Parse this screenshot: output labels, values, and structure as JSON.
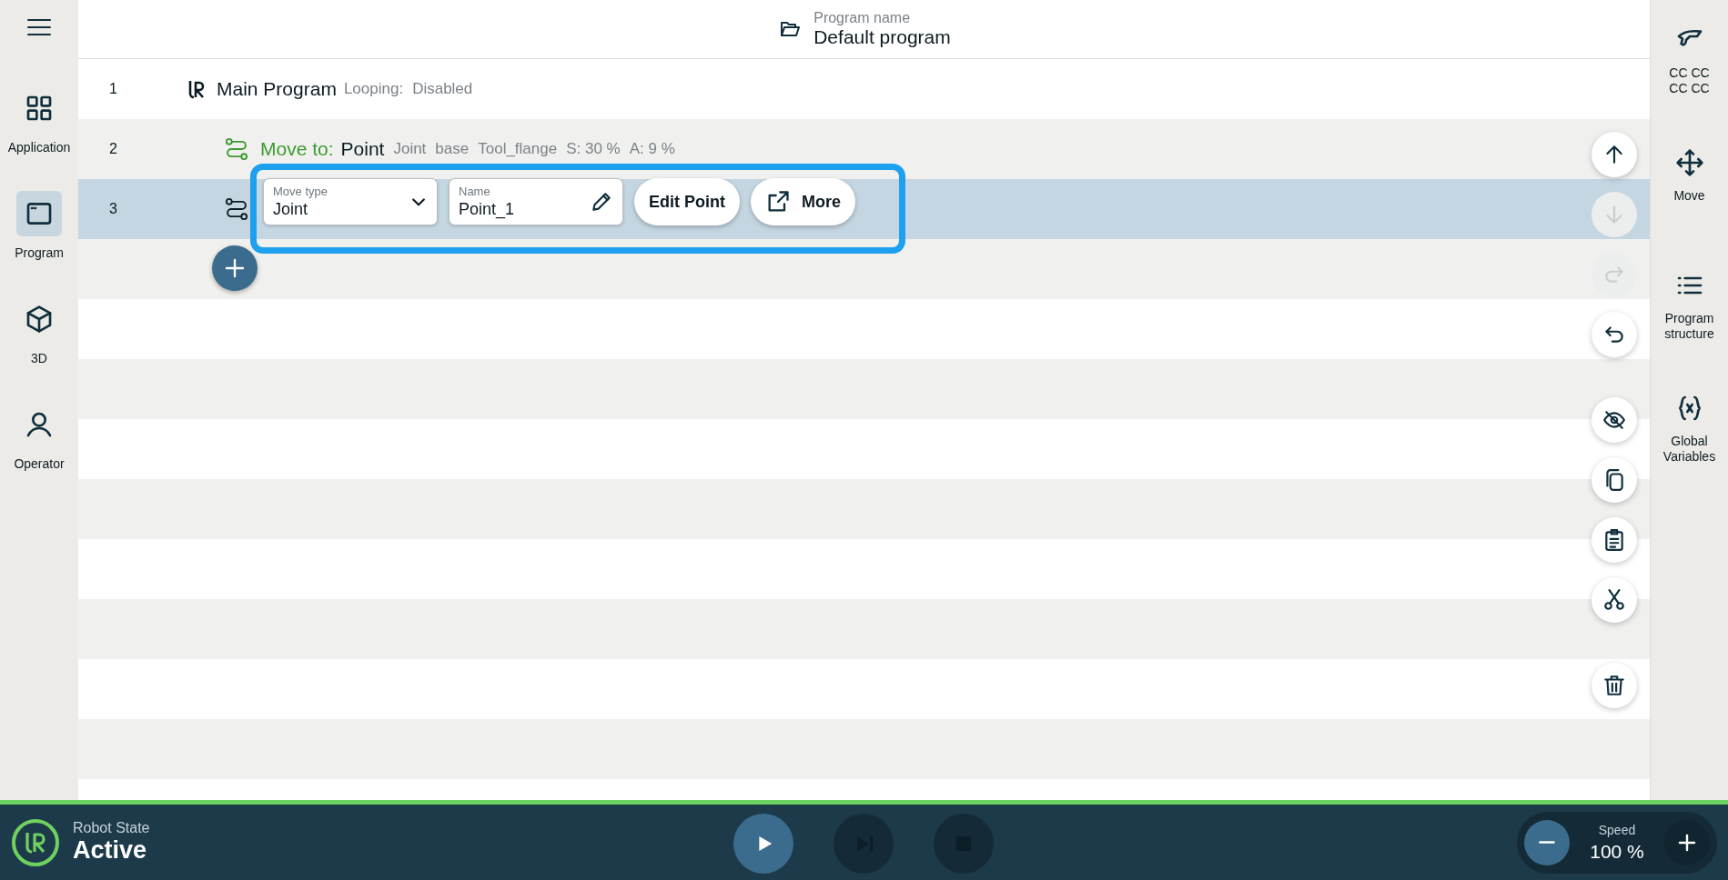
{
  "nav": {
    "items": [
      {
        "kind": "application",
        "label": "Application",
        "selected": false
      },
      {
        "kind": "program",
        "label": "Program",
        "selected": true
      },
      {
        "kind": "cube",
        "label": "3D",
        "selected": false
      },
      {
        "kind": "operator",
        "label": "Operator",
        "selected": false
      }
    ]
  },
  "header": {
    "label": "Program name",
    "value": "Default program"
  },
  "program": [
    {
      "number": "1",
      "kind": "main",
      "title": "Main Program",
      "details": [
        "Looping:",
        "Disabled"
      ],
      "selected": false,
      "children": [
        {
          "number": "2",
          "kind": "move",
          "title": "Move to:",
          "name": "Point",
          "details": [
            "Joint",
            "base",
            "Tool_flange",
            "S: 30 %",
            "A: 9 %"
          ],
          "selected": false
        },
        {
          "number": "3",
          "kind": "move",
          "selected": true,
          "editor": {
            "move_type": {
              "label": "Move type",
              "value": "Joint"
            },
            "name": {
              "label": "Name",
              "value": "Point_1"
            },
            "buttons": [
              {
                "kind": "text",
                "label": "Edit Point"
              },
              {
                "kind": "open",
                "label": "More"
              }
            ]
          }
        }
      ]
    }
  ],
  "actions": [
    {
      "kind": "up",
      "disabled": false
    },
    {
      "kind": "down",
      "disabled": true
    },
    {
      "kind": "redo",
      "disabled": true
    },
    {
      "kind": "undo",
      "disabled": false
    },
    {
      "kind": "hide",
      "disabled": false
    },
    {
      "kind": "copy",
      "disabled": false
    },
    {
      "kind": "paste",
      "disabled": false
    },
    {
      "kind": "cut",
      "disabled": false
    },
    {
      "kind": "delete",
      "disabled": false
    }
  ],
  "side": [
    {
      "kind": "tool",
      "label": "CC CC\nCC CC"
    },
    {
      "kind": "move",
      "label": "Move"
    },
    {
      "kind": "structure",
      "label": "Program structure"
    },
    {
      "kind": "variables",
      "label": "Global Variables"
    }
  ],
  "footer": {
    "robot_state": {
      "label": "Robot State",
      "value": "Active"
    },
    "controls": [
      {
        "kind": "play",
        "disabled": false
      },
      {
        "kind": "step",
        "disabled": true
      },
      {
        "kind": "stop",
        "disabled": true
      }
    ],
    "speed": {
      "label": "Speed",
      "value": "100 %"
    }
  }
}
